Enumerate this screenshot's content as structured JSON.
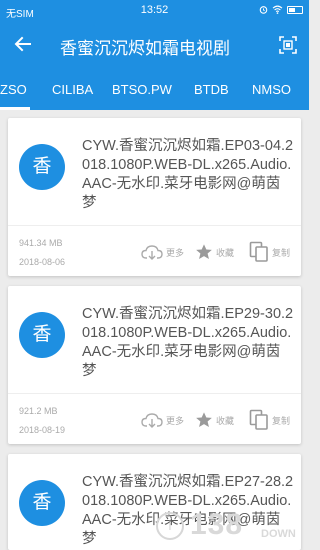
{
  "status_bar": {
    "carrier": "无SIM",
    "time": "13:52"
  },
  "app_bar": {
    "title": "香蜜沉沉烬如霜电视剧",
    "back_icon": "back-arrow-icon",
    "action_icon": "select-frame-icon"
  },
  "tabs": [
    {
      "label": "ZSO",
      "active": true
    },
    {
      "label": "CILIBA",
      "active": false
    },
    {
      "label": "BTSO.PW",
      "active": false
    },
    {
      "label": "BTDB",
      "active": false
    },
    {
      "label": "NMSO",
      "active": false
    }
  ],
  "results": [
    {
      "avatar": "香",
      "title": "CYW.香蜜沉沉烬如霜.EP03-04.2018.1080P.WEB-DL.x265.Audio.AAC-无水印.菜牙电影网@萌茵梦",
      "size": "941.34 MB",
      "date": "2018-08-06",
      "actions": {
        "more": "更多",
        "favorite": "收藏",
        "copy": "复制"
      }
    },
    {
      "avatar": "香",
      "title": "CYW.香蜜沉沉烬如霜.EP29-30.2018.1080P.WEB-DL.x265.Audio.AAC-无水印.菜牙电影网@萌茵梦",
      "size": "921.2 MB",
      "date": "2018-08-19",
      "actions": {
        "more": "更多",
        "favorite": "收藏",
        "copy": "复制"
      }
    },
    {
      "avatar": "香",
      "title": "CYW.香蜜沉沉烬如霜.EP27-28.2018.1080P.WEB-DL.x265.Audio.AAC-无水印.菜牙电影网@萌茵梦",
      "size": "",
      "date": "",
      "actions": {
        "more": "",
        "favorite": "",
        "copy": ""
      }
    }
  ],
  "watermark": {
    "logo": "i",
    "text": "138",
    "sub": "DOWN"
  },
  "colors": {
    "primary": "#1e8fe1",
    "background": "#ececec",
    "card": "#ffffff",
    "text_title": "#555555",
    "text_meta": "#aaaaaa"
  }
}
